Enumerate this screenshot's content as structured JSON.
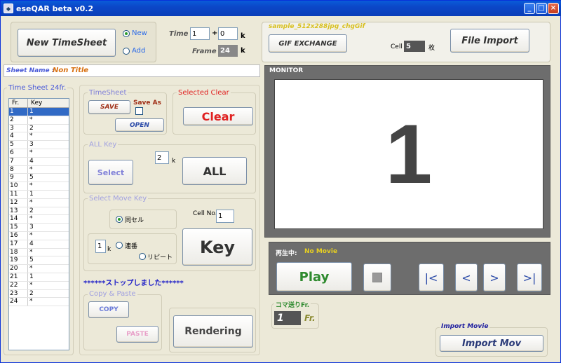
{
  "window": {
    "title": "eseQAR beta v0.2",
    "app_icon": "app-icon",
    "controls": {
      "minimize": "_",
      "maximize": "□",
      "close": "×"
    }
  },
  "top": {
    "new_timesheet_label": "New TimeSheet",
    "radio_new": "New",
    "radio_add": "Add",
    "time_label": "Time",
    "time_value": "1",
    "plus": "+",
    "time_extra": "0",
    "k1": "k",
    "frame_label": "Frame",
    "frame_value": "24",
    "k2": "k",
    "gif_name": "sample_512x288jpg_chgGif",
    "gif_exchange_label": "GIF EXCHANGE",
    "cell_label": "Cell",
    "cell_value": "5",
    "cell_unit": "枚",
    "file_import_label": "File Import"
  },
  "sheet_name": {
    "label": "Sheet Name :",
    "value": "Non Title"
  },
  "timesheet_table": {
    "title": "Time Sheet  24fr.",
    "headers": [
      "Fr.",
      "Key"
    ],
    "rows": [
      [
        "1",
        "1"
      ],
      [
        "2",
        "*"
      ],
      [
        "3",
        "2"
      ],
      [
        "4",
        "*"
      ],
      [
        "5",
        "3"
      ],
      [
        "6",
        "*"
      ],
      [
        "7",
        "4"
      ],
      [
        "8",
        "*"
      ],
      [
        "9",
        "5"
      ],
      [
        "10",
        "*"
      ],
      [
        "11",
        "1"
      ],
      [
        "12",
        "*"
      ],
      [
        "13",
        "2"
      ],
      [
        "14",
        "*"
      ],
      [
        "15",
        "3"
      ],
      [
        "16",
        "*"
      ],
      [
        "17",
        "4"
      ],
      [
        "18",
        "*"
      ],
      [
        "19",
        "5"
      ],
      [
        "20",
        "*"
      ],
      [
        "21",
        "1"
      ],
      [
        "22",
        "*"
      ],
      [
        "23",
        "2"
      ],
      [
        "24",
        "*"
      ]
    ]
  },
  "timesheet_group": {
    "label": "TimeSheet",
    "save": "SAVE",
    "save_as": "Save As",
    "open": "OPEN"
  },
  "selected_clear": {
    "label": "Selected Clear",
    "clear": "Clear"
  },
  "all_key": {
    "label": "ALL Key",
    "select": "Select",
    "value": "2",
    "k": "k",
    "all": "ALL"
  },
  "select_move_key": {
    "label": "Select Move Key",
    "same_cell": "同セル",
    "cell_no_label": "Cell No.",
    "cell_no_value": "1",
    "step_value": "1",
    "k": "k",
    "sequential": "連番",
    "repeat": "リピート",
    "key": "Key"
  },
  "status_message": "******ストップしました******",
  "copy_paste": {
    "label": "Copy & Paste",
    "copy": "COPY",
    "paste": "PASTE"
  },
  "rendering_label": "Rendering",
  "monitor": {
    "label": "MONITOR",
    "frame_display": "1"
  },
  "player": {
    "now_playing_label": "再生中:",
    "now_playing_value": "No Movie",
    "play": "Play",
    "stop_icon": "stop-icon",
    "first": "|<",
    "prev": "<",
    "next": ">",
    "last": ">|"
  },
  "frame_step": {
    "label": "コマ送りFr.",
    "value": "1",
    "unit": "Fr."
  },
  "import_movie": {
    "label": "Import Movie",
    "button": "Import Mov"
  },
  "colors": {
    "title_blue": "#0b47c8",
    "accent_blue": "#4b5bd8",
    "red": "#e02020",
    "gold": "#d8c020",
    "green": "#2e8a2e",
    "olive": "#8a8a30"
  }
}
